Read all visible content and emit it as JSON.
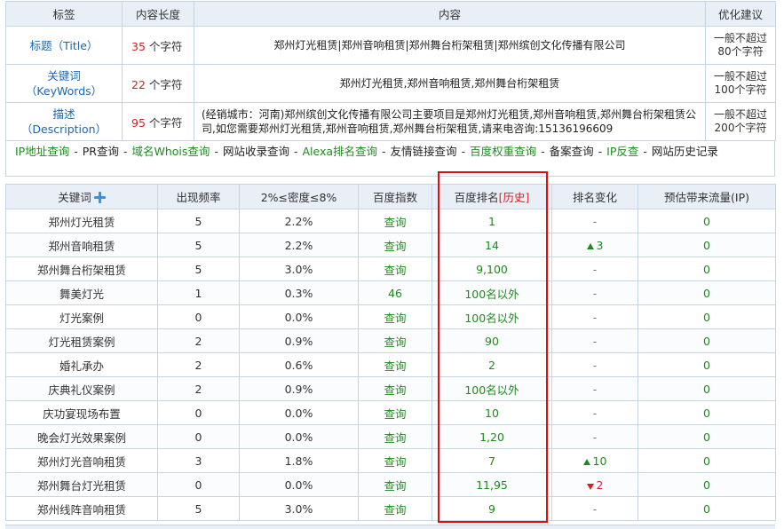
{
  "summary": {
    "headers": [
      "标签",
      "内容长度",
      "内容",
      "优化建议"
    ],
    "rows": [
      {
        "label_l1": "标题（Title）",
        "label_l2": "",
        "len_num": "35",
        "len_unit": "个字符",
        "content": "郑州灯光租赁|郑州音响租赁|郑州舞台桁架租赁|郑州缤创文化传播有限公司",
        "adv_l1": "一般不超过",
        "adv_l2": "80个字符"
      },
      {
        "label_l1": "关键词",
        "label_l2": "（KeyWords）",
        "len_num": "22",
        "len_unit": "个字符",
        "content": "郑州灯光租赁,郑州音响租赁,郑州舞台桁架租赁",
        "adv_l1": "一般不超过",
        "adv_l2": "100个字符"
      },
      {
        "label_l1": "描述",
        "label_l2": "（Description）",
        "len_num": "95",
        "len_unit": "个字符",
        "content": "(经销城市：河南)郑州缤创文化传播有限公司主要项目是郑州灯光租赁,郑州音响租赁,郑州舞台桁架租赁公司,如您需要郑州灯光租赁,郑州音响租赁,郑州舞台桁架租赁,请来电咨询:15136196609",
        "adv_l1": "一般不超过",
        "adv_l2": "200个字符"
      }
    ]
  },
  "quick_links": [
    {
      "text": "IP地址查询",
      "color": "green"
    },
    {
      "text": "PR查询",
      "color": "dark"
    },
    {
      "text": "域名Whois查询",
      "color": "green"
    },
    {
      "text": "网站收录查询",
      "color": "dark"
    },
    {
      "text": "Alexa排名查询",
      "color": "green"
    },
    {
      "text": "友情链接查询",
      "color": "dark"
    },
    {
      "text": "百度权重查询",
      "color": "green"
    },
    {
      "text": "备案查询",
      "color": "dark"
    },
    {
      "text": "IP反查",
      "color": "green"
    },
    {
      "text": "网站历史记录",
      "color": "dark"
    }
  ],
  "link_separator": "-",
  "keywords": {
    "headers": {
      "keyword": "关键词",
      "freq": "出现频率",
      "density": "2%≤密度≤8%",
      "baidu_index": "百度指数",
      "rank": "百度排名",
      "rank_history": "[历史]",
      "change": "排名变化",
      "traffic": "预估带来流量(IP)"
    },
    "rows": [
      {
        "kw": "郑州灯光租赁",
        "freq": "5",
        "density": "2.2%",
        "index": "查询",
        "rank": "1",
        "change": "-",
        "dir": "",
        "traffic": "0"
      },
      {
        "kw": "郑州音响租赁",
        "freq": "5",
        "density": "2.2%",
        "index": "查询",
        "rank": "14",
        "change": "3",
        "dir": "up",
        "traffic": "0"
      },
      {
        "kw": "郑州舞台桁架租赁",
        "freq": "5",
        "density": "3.0%",
        "index": "查询",
        "rank": "9,100",
        "change": "-",
        "dir": "",
        "traffic": "0"
      },
      {
        "kw": "舞美灯光",
        "freq": "1",
        "density": "0.3%",
        "index": "46",
        "rank": "100名以外",
        "change": "-",
        "dir": "",
        "traffic": "0"
      },
      {
        "kw": "灯光案例",
        "freq": "0",
        "density": "0.0%",
        "index": "查询",
        "rank": "100名以外",
        "change": "-",
        "dir": "",
        "traffic": "0"
      },
      {
        "kw": "灯光租赁案例",
        "freq": "2",
        "density": "0.9%",
        "index": "查询",
        "rank": "90",
        "change": "-",
        "dir": "",
        "traffic": "0"
      },
      {
        "kw": "婚礼承办",
        "freq": "2",
        "density": "0.6%",
        "index": "查询",
        "rank": "2",
        "change": "-",
        "dir": "",
        "traffic": "0"
      },
      {
        "kw": "庆典礼仪案例",
        "freq": "2",
        "density": "0.9%",
        "index": "查询",
        "rank": "100名以外",
        "change": "-",
        "dir": "",
        "traffic": "0"
      },
      {
        "kw": "庆功宴现场布置",
        "freq": "0",
        "density": "0.0%",
        "index": "查询",
        "rank": "10",
        "change": "-",
        "dir": "",
        "traffic": "0"
      },
      {
        "kw": "晚会灯光效果案例",
        "freq": "0",
        "density": "0.0%",
        "index": "查询",
        "rank": "1,20",
        "change": "-",
        "dir": "",
        "traffic": "0"
      },
      {
        "kw": "郑州灯光音响租赁",
        "freq": "3",
        "density": "1.8%",
        "index": "查询",
        "rank": "7",
        "change": "10",
        "dir": "up",
        "traffic": "0"
      },
      {
        "kw": "郑州舞台灯光租赁",
        "freq": "0",
        "density": "0.0%",
        "index": "查询",
        "rank": "11,95",
        "change": "2",
        "dir": "down",
        "traffic": "0"
      },
      {
        "kw": "郑州线阵音响租赁",
        "freq": "5",
        "density": "3.0%",
        "index": "查询",
        "rank": "9",
        "change": "-",
        "dir": "",
        "traffic": "0"
      }
    ]
  },
  "colors": {
    "green": "#1e8a1e",
    "red": "#d92020",
    "blue": "#1a68b5",
    "header_bg": "#e8eff6",
    "border": "#c7d5e2",
    "highlight_box": "#e01010"
  }
}
